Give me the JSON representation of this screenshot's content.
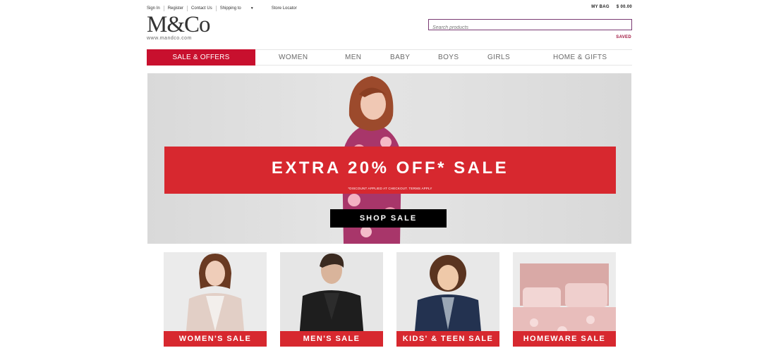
{
  "header": {
    "links": [
      "Sign In",
      "Register",
      "Contact Us",
      "Shipping to"
    ],
    "store_locator": "Store Locator",
    "bag_label": "MY BAG",
    "bag_amount": "$ 00.00",
    "saved": "SAVED",
    "search_placeholder": "Search products"
  },
  "logo": {
    "mark": "M&Co",
    "url": "www.mandco.com"
  },
  "nav": {
    "sale": "SALE & OFFERS",
    "items": [
      "WOMEN",
      "MEN",
      "BABY",
      "BOYS",
      "GIRLS",
      "HOME & GIFTS"
    ]
  },
  "hero": {
    "headline": "EXTRA 20% OFF* SALE",
    "terms": "*DISCOUNT APPLIED AT CHECKOUT. TERMS APPLY",
    "cta": "SHOP SALE"
  },
  "tiles": [
    {
      "label": "WOMEN'S SALE"
    },
    {
      "label": "MEN'S SALE"
    },
    {
      "label": "KIDS' & TEEN SALE"
    },
    {
      "label": "HOMEWARE SALE"
    }
  ],
  "colors": {
    "brand_red": "#c8102e",
    "banner_red": "#d7282f",
    "search_border": "#7a3a72"
  }
}
